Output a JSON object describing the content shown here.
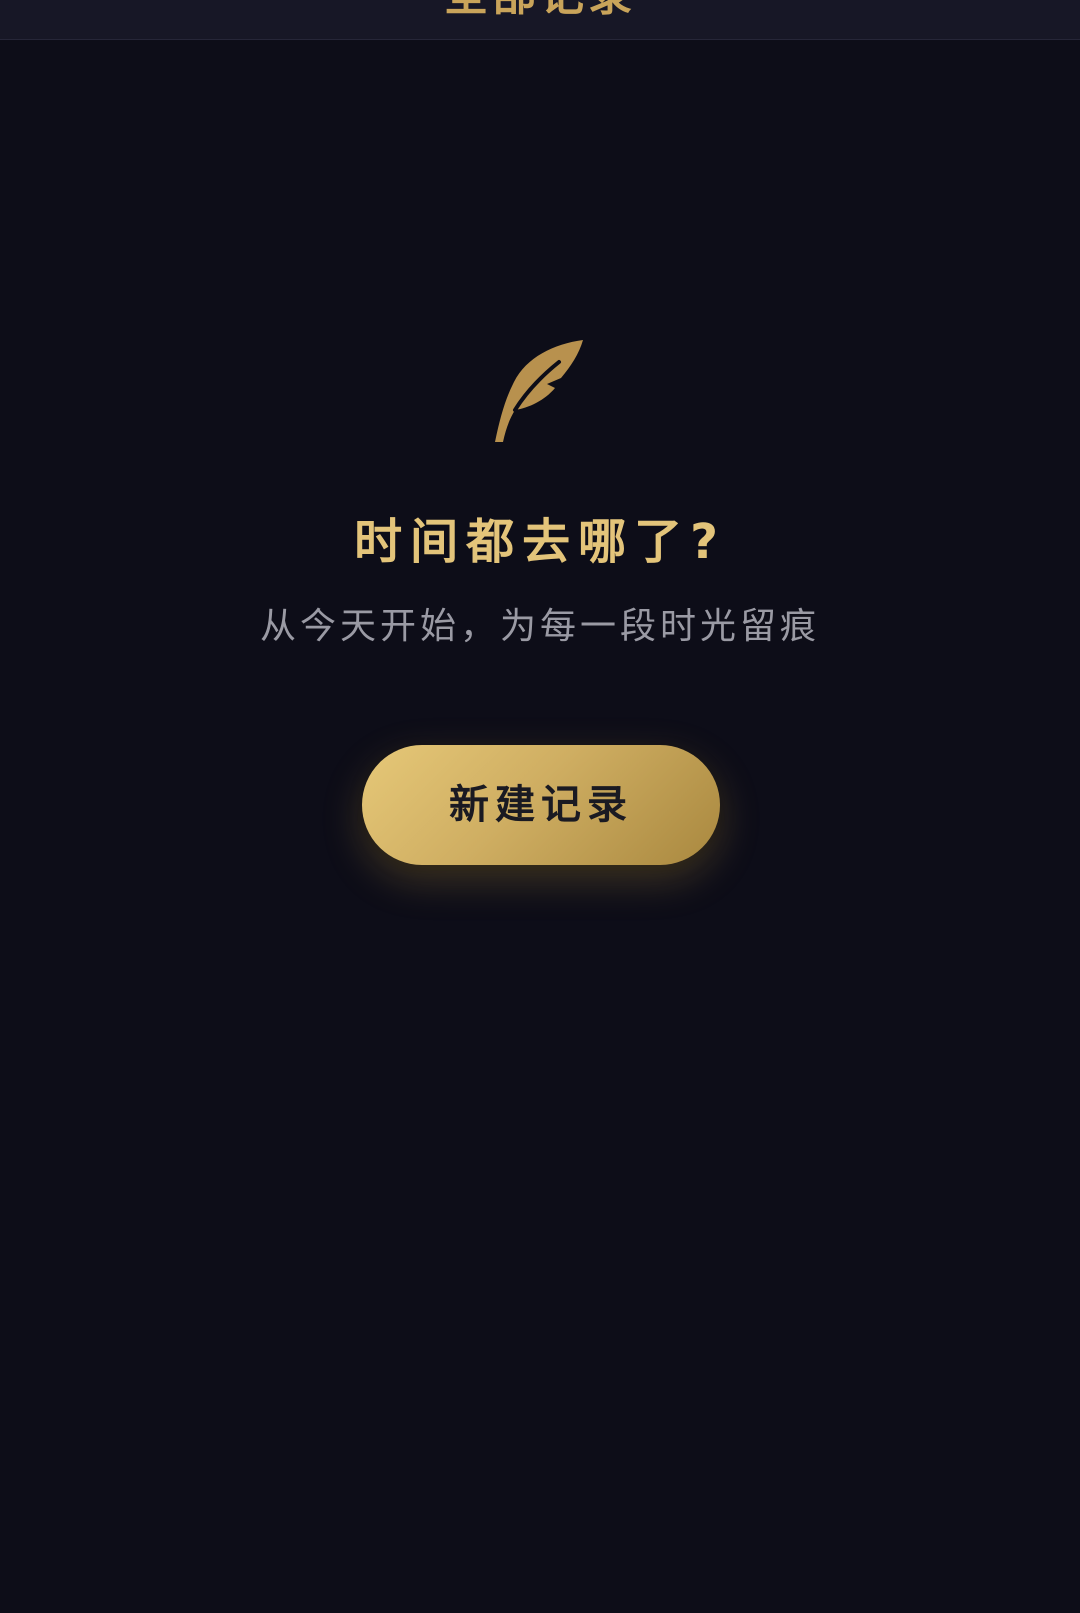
{
  "header": {
    "title": "全部记录"
  },
  "empty_state": {
    "icon": "feather-icon",
    "title": "时间都去哪了?",
    "subtitle": "从今天开始，为每一段时光留痕",
    "button_label": "新建记录"
  },
  "colors": {
    "background": "#0d0d18",
    "header_background": "#171726",
    "accent_gold": "#e3c47a",
    "icon_gold": "#b8914e",
    "subtitle_gray": "#9a9aa4",
    "button_text": "#1a1a22"
  }
}
